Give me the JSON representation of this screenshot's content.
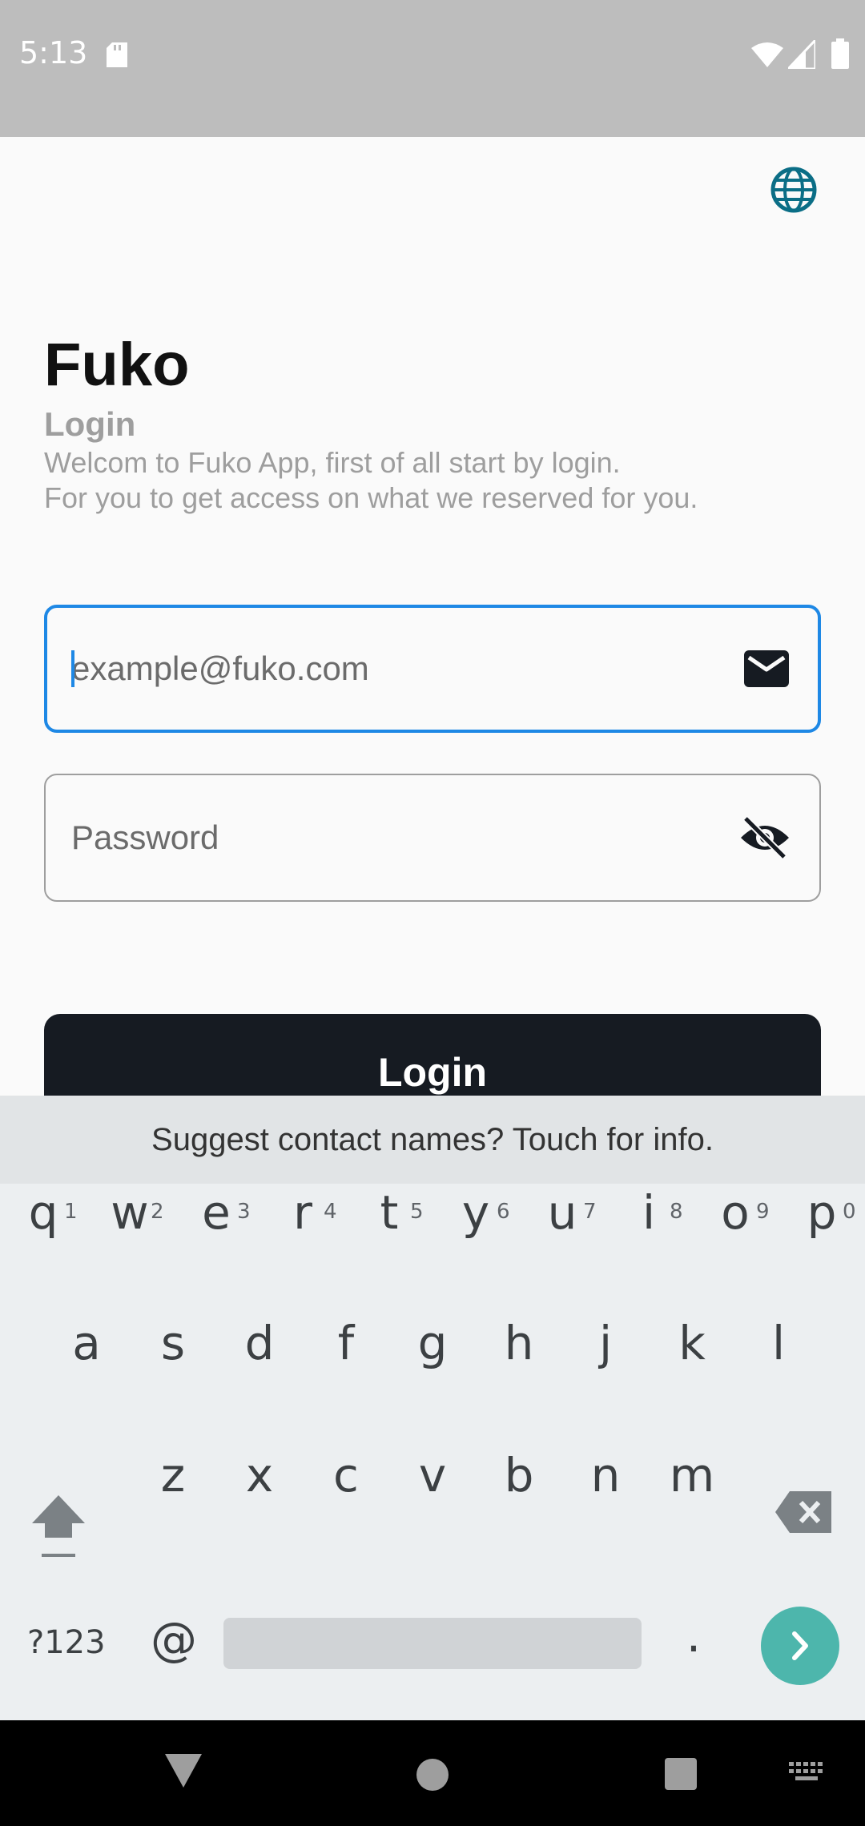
{
  "status_bar": {
    "time": "5:13",
    "icons": [
      "sd-card-icon",
      "wifi-icon",
      "signal-icon",
      "battery-icon"
    ]
  },
  "header": {
    "language_icon": "globe-icon",
    "accent_color": "#0b6e86"
  },
  "login_screen": {
    "title": "Fuko",
    "subtitle": "Login",
    "description_line1": "Welcom to Fuko App, first of all start by login.",
    "description_line2": "For you to get access on what we reserved for you.",
    "email": {
      "placeholder": "example@fuko.com",
      "value": "",
      "icon": "mail-icon",
      "focused": true
    },
    "password": {
      "placeholder": "Password",
      "value": "",
      "icon": "eye-off-icon"
    },
    "login_button": "Login",
    "button_color": "#161b22",
    "focus_color": "#1e88e5"
  },
  "keyboard": {
    "suggestion": "Suggest contact names? Touch for info.",
    "row1": [
      {
        "key": "q",
        "hint": "1"
      },
      {
        "key": "w",
        "hint": "2"
      },
      {
        "key": "e",
        "hint": "3"
      },
      {
        "key": "r",
        "hint": "4"
      },
      {
        "key": "t",
        "hint": "5"
      },
      {
        "key": "y",
        "hint": "6"
      },
      {
        "key": "u",
        "hint": "7"
      },
      {
        "key": "i",
        "hint": "8"
      },
      {
        "key": "o",
        "hint": "9"
      },
      {
        "key": "p",
        "hint": "0"
      }
    ],
    "row2": [
      "a",
      "s",
      "d",
      "f",
      "g",
      "h",
      "j",
      "k",
      "l"
    ],
    "row3": [
      "z",
      "x",
      "c",
      "v",
      "b",
      "n",
      "m"
    ],
    "symbols_key": "?123",
    "at_key": "@",
    "period_key": ".",
    "enter_color": "#4db6ac"
  },
  "nav_bar": {
    "icons": [
      "back-icon",
      "home-icon",
      "recents-icon",
      "keyboard-switch-icon"
    ]
  }
}
